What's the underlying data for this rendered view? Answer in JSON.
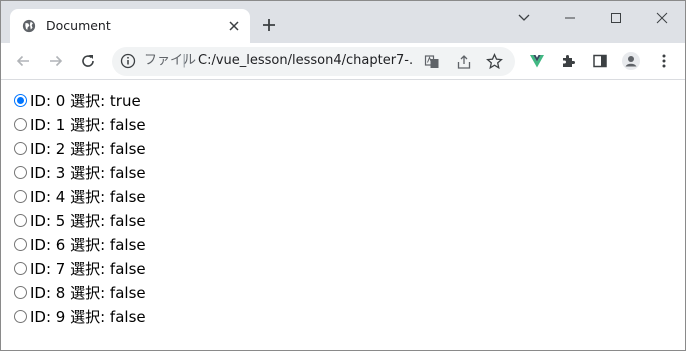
{
  "tab": {
    "title": "Document"
  },
  "address": {
    "scheme_label": "ファイル",
    "separator": "|",
    "url": "C:/vue_lesson/lesson4/chapter7-..."
  },
  "colors": {
    "radio_checked": "#0075ff",
    "vue_green": "#41b883",
    "vue_dark": "#35495e"
  },
  "rows": [
    {
      "text": "ID: 0 選択: true",
      "checked": true
    },
    {
      "text": "ID: 1 選択: false",
      "checked": false
    },
    {
      "text": "ID: 2 選択: false",
      "checked": false
    },
    {
      "text": "ID: 3 選択: false",
      "checked": false
    },
    {
      "text": "ID: 4 選択: false",
      "checked": false
    },
    {
      "text": "ID: 5 選択: false",
      "checked": false
    },
    {
      "text": "ID: 6 選択: false",
      "checked": false
    },
    {
      "text": "ID: 7 選択: false",
      "checked": false
    },
    {
      "text": "ID: 8 選択: false",
      "checked": false
    },
    {
      "text": "ID: 9 選択: false",
      "checked": false
    }
  ]
}
